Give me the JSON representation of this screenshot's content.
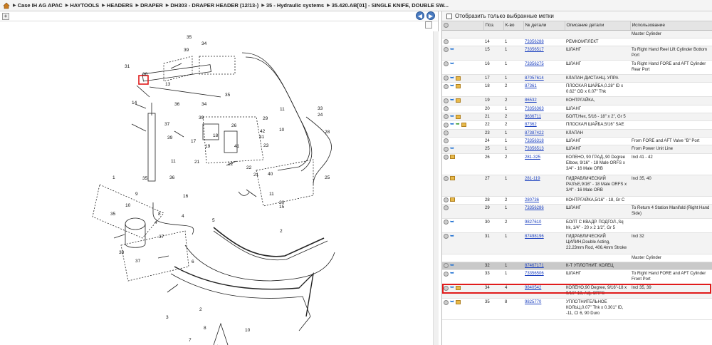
{
  "breadcrumb": [
    "Case IH AG APAC",
    "HAYTOOLS",
    "HEADERS",
    "DRAPER",
    "DH303 - DRAPER HEADER (12/13-)",
    "35 - Hydraulic systems",
    "35.420.AB[01] - SINGLE KNIFE, DOUBLE SW..."
  ],
  "filter_label": "Отобразить только выбранные метки",
  "columns": [
    "Поз.",
    "К-во",
    "№ детали",
    "Описание детали",
    "Использование"
  ],
  "rows": [
    {
      "pos": "",
      "qty": "",
      "part": "",
      "desc": "",
      "usage": "Master Cylinder",
      "icons": []
    },
    {
      "pos": "14",
      "qty": "1",
      "part": "73356288",
      "desc": "РЕМКОМПЛЕКТ",
      "usage": "",
      "icons": [
        "circle"
      ]
    },
    {
      "pos": "15",
      "qty": "1",
      "part": "73356517",
      "desc": "ШЛАНГ",
      "usage": "To Right Hand Reel Lift Cylinder Bottom Port",
      "icons": [
        "circle",
        "blue"
      ]
    },
    {
      "pos": "16",
      "qty": "1",
      "part": "73356275",
      "desc": "ШЛАНГ",
      "usage": "To Right Hand FORE and AFT Cylinder Rear Port",
      "icons": [
        "circle",
        "blue"
      ]
    },
    {
      "pos": "17",
      "qty": "1",
      "part": "87057614",
      "desc": "КЛАПАН ДИСТАНЦ. УПРА",
      "usage": "",
      "icons": [
        "circle",
        "blue",
        "box"
      ]
    },
    {
      "pos": "18",
      "qty": "2",
      "part": "87361",
      "desc": "ПЛОСКАЯ ШАЙБА,0.28\" ID x 0.62\" OD x 0.07\" Thk",
      "usage": "",
      "icons": [
        "circle",
        "blue",
        "box"
      ]
    },
    {
      "pos": "19",
      "qty": "2",
      "part": "86532",
      "desc": "КОНТРГАЙКА,",
      "usage": "",
      "icons": [
        "circle",
        "blue",
        "box"
      ]
    },
    {
      "pos": "20",
      "qty": "1",
      "part": "73356363",
      "desc": "ШЛАНГ",
      "usage": "",
      "icons": [
        "circle"
      ]
    },
    {
      "pos": "21",
      "qty": "2",
      "part": "9636711",
      "desc": "БОЛТ,Hex, 5/16 - 18\" x 2\", Gr 5",
      "usage": "",
      "icons": [
        "circle",
        "blue",
        "box"
      ]
    },
    {
      "pos": "22",
      "qty": "2",
      "part": "87362",
      "desc": "ПЛОСКАЯ ШАЙБА,5/16\" SAE",
      "usage": "",
      "icons": [
        "circle",
        "blue",
        "green",
        "box"
      ]
    },
    {
      "pos": "23",
      "qty": "1",
      "part": "87387422",
      "desc": "КЛАПАН",
      "usage": "",
      "icons": [
        "circle"
      ]
    },
    {
      "pos": "24",
      "qty": "1",
      "part": "73356318",
      "desc": "ШЛАНГ",
      "usage": "From FORE and AFT Valve \"B\" Port",
      "icons": [
        "circle"
      ]
    },
    {
      "pos": "25",
      "qty": "1",
      "part": "73356513",
      "desc": "ШЛАНГ",
      "usage": "From Power Unit Line",
      "icons": [
        "circle",
        "blue"
      ]
    },
    {
      "pos": "26",
      "qty": "2",
      "part": "281-325",
      "desc": "КОЛЕНО, 90 ГРАД.,90 Degree Elbow, 9/16\" - 18 Male ORFS x 3/4\" - 16 Male ORB",
      "usage": "Incl 41 - 42",
      "icons": [
        "circle",
        "box"
      ]
    },
    {
      "pos": "27",
      "qty": "1",
      "part": "281-119",
      "desc": "ГИДРАВЛИЧЕСКИЙ РАЗЪЕ,9/16\" - 18 Male ORFS x 3/4\" - 16 Male ORB",
      "usage": "Incl 35, 40",
      "icons": [
        "circle",
        "box"
      ]
    },
    {
      "pos": "28",
      "qty": "2",
      "part": "280736",
      "desc": "КОНТРГАЙКА,5/16\" - 18, Gr C",
      "usage": "",
      "icons": [
        "circle",
        "box"
      ]
    },
    {
      "pos": "29",
      "qty": "1",
      "part": "73356286",
      "desc": "ШЛАНГ",
      "usage": "To Return 4 Station Manifold (Right Hand Side)",
      "icons": [
        "circle"
      ]
    },
    {
      "pos": "30",
      "qty": "2",
      "part": "9827610",
      "desc": "БОЛТ С КВАДР. ПОДГОЛ.,Sq hk, 1/4\" - 20 x 2 1/2\", Gr 5",
      "usage": "",
      "icons": [
        "circle",
        "blue"
      ]
    },
    {
      "pos": "31",
      "qty": "1",
      "part": "87498196",
      "desc": "ГИДРАВЛИЧЕСКИЙ ЦИЛИН,Double Acting, 22.23mm Rod, 406.4mm Stroke",
      "usage": "Incl 32",
      "icons": [
        "circle",
        "blue"
      ]
    },
    {
      "pos": "",
      "qty": "",
      "part": "",
      "desc": "",
      "usage": "Master Cylinder",
      "icons": []
    },
    {
      "pos": "32",
      "qty": "1",
      "part": "87467171",
      "desc": "К-Т УПЛОТНИТ. КОЛЕЦ",
      "usage": "",
      "icons": [
        "circle",
        "blue"
      ],
      "highlight": true
    },
    {
      "pos": "33",
      "qty": "1",
      "part": "73356506",
      "desc": "ШЛАНГ",
      "usage": "To Right Hand FORE and AFT Cylinder Front Port",
      "icons": [
        "circle",
        "blue"
      ]
    },
    {
      "pos": "34",
      "qty": "4",
      "part": "9840542",
      "desc": "КОЛЕНО,90 Degree, 9/16\"-18 x 9/16\"-18, Adj, ORFS",
      "usage": "Incl 35, 39",
      "icons": [
        "circle",
        "blue",
        "box"
      ]
    },
    {
      "pos": "35",
      "qty": "8",
      "part": "9825770",
      "desc": "УПЛОТНИТЕЛЬНОЕ КОЛЬЦ,0.07\" Thk x 0.301\" ID, -11, CI 6, 90 Duro",
      "usage": "",
      "icons": [
        "circle",
        "blue",
        "box"
      ]
    }
  ],
  "diagram_labels": [
    "35",
    "34",
    "39",
    "31",
    "30",
    "13",
    "14",
    "36",
    "34",
    "35",
    "39",
    "29",
    "33",
    "11",
    "24",
    "37",
    "39",
    "26",
    "42",
    "41",
    "10",
    "18",
    "17",
    "19",
    "41",
    "23",
    "28",
    "21",
    "12",
    "11",
    "36",
    "40",
    "22",
    "21",
    "25",
    "1",
    "35",
    "9",
    "10",
    "11",
    "20",
    "15",
    "16",
    "35",
    "2",
    "8",
    "2",
    "4",
    "4",
    "37",
    "38",
    "37",
    "5",
    "6",
    "3",
    "8",
    "7",
    "10"
  ]
}
